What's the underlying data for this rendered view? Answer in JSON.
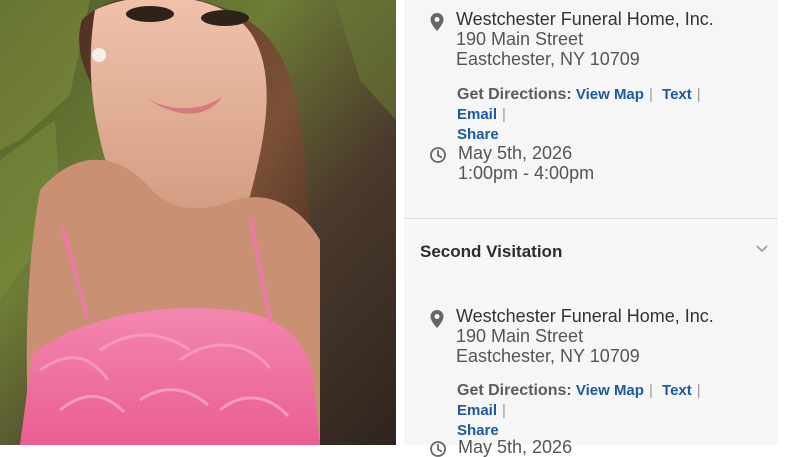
{
  "photo": {
    "description_icon": "portrait-photo"
  },
  "first_visitation": {
    "location_name": "Westchester Funeral Home, Inc.",
    "address_line1": "190 Main Street",
    "address_line2": "Eastchester, NY 10709",
    "directions_label": "Get Directions:",
    "links": [
      "View Map",
      "Text",
      "Email",
      "Share"
    ],
    "date": "May 5th, 2026",
    "time": "1:00pm - 4:00pm"
  },
  "second_visitation": {
    "title": "Second Visitation",
    "location_name": "Westchester Funeral Home, Inc.",
    "address_line1": "190 Main Street",
    "address_line2": "Eastchester, NY 10709",
    "directions_label": "Get Directions:",
    "links": [
      "View Map",
      "Text",
      "Email",
      "Share"
    ],
    "date_partial": "May 5th, 2026"
  },
  "icons": {
    "location": "location-pin-icon",
    "time": "clock-icon",
    "expand": "chevron-down-icon"
  },
  "colors": {
    "link": "#1d5a9f",
    "text": "#555555",
    "panel_bg": "#f6f6f6"
  }
}
